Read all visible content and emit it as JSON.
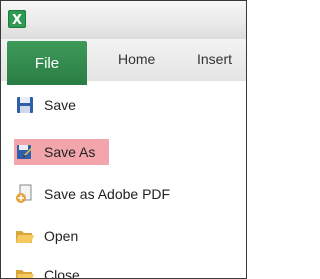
{
  "ribbon": {
    "file_label": "File",
    "tabs": [
      "Home",
      "Insert"
    ]
  },
  "file_menu": {
    "items": [
      {
        "label": "Save",
        "icon": "save-icon"
      },
      {
        "label": "Save As",
        "icon": "save-as-icon",
        "highlighted": true
      },
      {
        "label": "Save as Adobe PDF",
        "icon": "pdf-icon"
      },
      {
        "label": "Open",
        "icon": "open-folder-icon"
      },
      {
        "label": "Close",
        "icon": "close-folder-icon"
      }
    ]
  },
  "colors": {
    "file_tab": "#2e8549",
    "highlight": "#f2a5ab"
  }
}
